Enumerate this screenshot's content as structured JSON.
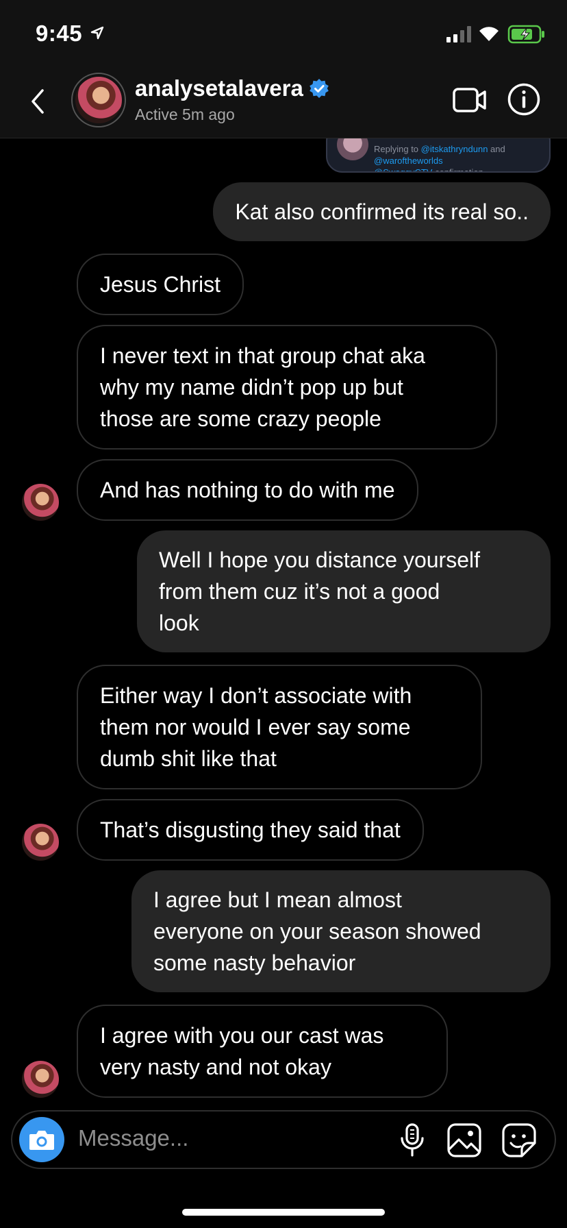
{
  "status_bar": {
    "time": "9:45"
  },
  "header": {
    "username": "analysetalavera",
    "active_status": "Active 5m ago",
    "verified": true
  },
  "shared_tweet": {
    "replying_prefix": "Replying to",
    "handle_1": "@itskathryndunn",
    "and_word": "and",
    "handle_2": "@waroftheworlds",
    "line_3_handle": "@SwaggyCTV",
    "line_3_text": "confirmation"
  },
  "messages": [
    {
      "direction": "out",
      "text": "Kat also confirmed its real so.."
    },
    {
      "direction": "in",
      "text": "Jesus Christ"
    },
    {
      "direction": "in",
      "lines": [
        "I never text in that group chat aka",
        "why my name didn’t pop up but",
        "those are some crazy people"
      ]
    },
    {
      "direction": "in",
      "text": "And has nothing to do with me"
    },
    {
      "direction": "out",
      "lines": [
        "Well I hope you distance yourself",
        "from them cuz it’s not a good",
        "look"
      ]
    },
    {
      "direction": "in",
      "lines": [
        "Either way I don’t associate with",
        "them nor would I ever say some",
        "dumb shit like that"
      ]
    },
    {
      "direction": "in",
      "text": "That’s disgusting they said that"
    },
    {
      "direction": "out",
      "lines": [
        "I agree but I mean almost",
        "everyone on your season showed",
        "some nasty behavior"
      ]
    },
    {
      "direction": "in",
      "lines": [
        "I agree with you our cast was",
        "very nasty and not okay"
      ]
    }
  ],
  "composer": {
    "placeholder": "Message..."
  },
  "icons": {
    "back": "chevron-left-icon",
    "verified": "verified-badge-icon",
    "video": "video-camera-icon",
    "info": "info-icon",
    "camera": "camera-icon",
    "mic": "microphone-icon",
    "gallery": "gallery-icon",
    "sticker": "sticker-icon"
  },
  "colors": {
    "accent": "#3897f0",
    "outgoing_bubble": "#262626",
    "incoming_border": "#2e2e2e",
    "secondary_text": "#a8a8a8",
    "battery_charging": "#5ac84b"
  }
}
